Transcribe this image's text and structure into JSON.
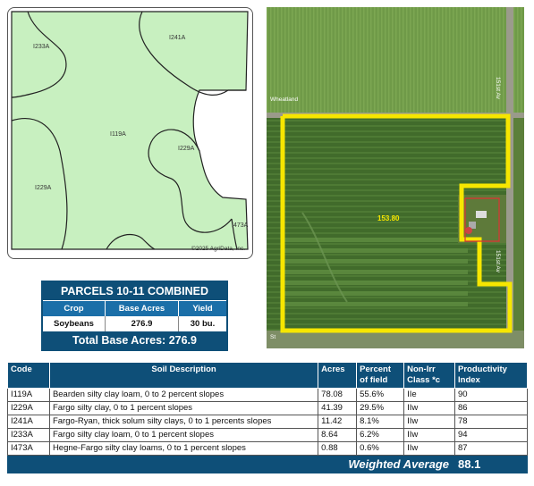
{
  "soil_map": {
    "labels": {
      "i233a": "I233A",
      "i241a": "I241A",
      "i119a": "I119A",
      "i229a_right": "I229A",
      "i229a_left": "I229A",
      "i473a": "I473A"
    },
    "copyright": "©2025 AgriData, Inc.",
    "fill_color": "#c8f0c0",
    "line_color": "#222222"
  },
  "aerial": {
    "road_top": "Wheatland",
    "road_right_top": "151st Av",
    "road_right_bottom": "151st Av",
    "road_bottom": "St",
    "boundary_color": "#f6e600",
    "acres": "153.80"
  },
  "parcels": {
    "title": "PARCELS 10-11 COMBINED",
    "headers": [
      "Crop",
      "Base Acres",
      "Yield"
    ],
    "rows": [
      [
        "Soybeans",
        "276.9",
        "30 bu."
      ]
    ],
    "total_label": "Total Base Acres:",
    "total_value": "276.9"
  },
  "soil_table": {
    "headers": {
      "code": "Code",
      "description": "Soil Description",
      "acres": "Acres",
      "percent": "Percent of field",
      "class": "Non-Irr Class *c",
      "productivity": "Productivity Index"
    },
    "rows": [
      {
        "code": "I119A",
        "description": "Bearden silty clay loam, 0 to 2 percent slopes",
        "acres": "78.08",
        "percent": "55.6%",
        "class": "IIe",
        "productivity": "90"
      },
      {
        "code": "I229A",
        "description": "Fargo silty clay, 0 to 1 percent slopes",
        "acres": "41.39",
        "percent": "29.5%",
        "class": "IIw",
        "productivity": "86"
      },
      {
        "code": "I241A",
        "description": "Fargo-Ryan, thick solum silty clays, 0 to 1 percents slopes",
        "acres": "11.42",
        "percent": "8.1%",
        "class": "IIw",
        "productivity": "78"
      },
      {
        "code": "I233A",
        "description": "Fargo silty clay loam, 0 to 1 percent slopes",
        "acres": "8.64",
        "percent": "6.2%",
        "class": "IIw",
        "productivity": "94"
      },
      {
        "code": "I473A",
        "description": "Hegne-Fargo silty clay loams, 0 to 1 percent slopes",
        "acres": "0.88",
        "percent": "0.6%",
        "class": "IIw",
        "productivity": "87"
      }
    ],
    "weighted_label": "Weighted Average",
    "weighted_value": "88.1"
  }
}
